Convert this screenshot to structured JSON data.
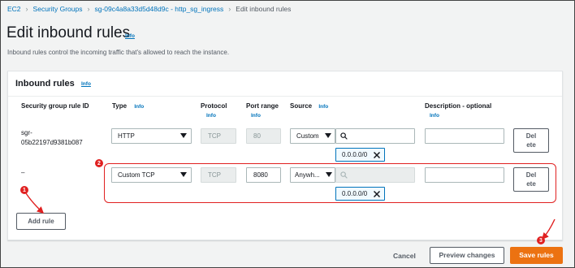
{
  "breadcrumb": {
    "items": [
      "EC2",
      "Security Groups",
      "sg-09c4a8a33d5d48d9c - http_sg_ingress"
    ],
    "current": "Edit inbound rules"
  },
  "page": {
    "title": "Edit inbound rules",
    "info": "Info",
    "description": "Inbound rules control the incoming traffic that's allowed to reach the instance."
  },
  "panel": {
    "title": "Inbound rules",
    "info": "Info",
    "columns": {
      "rule_id": "Security group rule ID",
      "type": "Type",
      "protocol": "Protocol",
      "port_range": "Port range",
      "source": "Source",
      "description": "Description - optional",
      "info": "Info"
    },
    "rows": [
      {
        "rule_id_line1": "sgr-",
        "rule_id_line2": "05b22197d9381b087",
        "type": "HTTP",
        "protocol": "TCP",
        "port_range": "80",
        "source_type": "Custom",
        "source_value": "",
        "cidr_token": "0.0.0.0/0",
        "description": "",
        "delete_line1": "Del",
        "delete_line2": "ete"
      },
      {
        "rule_id_line1": "–",
        "rule_id_line2": "",
        "type": "Custom TCP",
        "protocol": "TCP",
        "port_range": "8080",
        "source_type": "Anywh...",
        "source_value": "",
        "cidr_token": "0.0.0.0/0",
        "description": "",
        "delete_line1": "Del",
        "delete_line2": "ete"
      }
    ],
    "add_rule": "Add rule"
  },
  "footer": {
    "cancel": "Cancel",
    "preview": "Preview changes",
    "save": "Save rules"
  },
  "annotations": {
    "badge1": "1",
    "badge2": "2",
    "badge3": "3"
  },
  "colors": {
    "link": "#0073bb",
    "primary": "#ec7211",
    "annotation": "#e02020"
  }
}
